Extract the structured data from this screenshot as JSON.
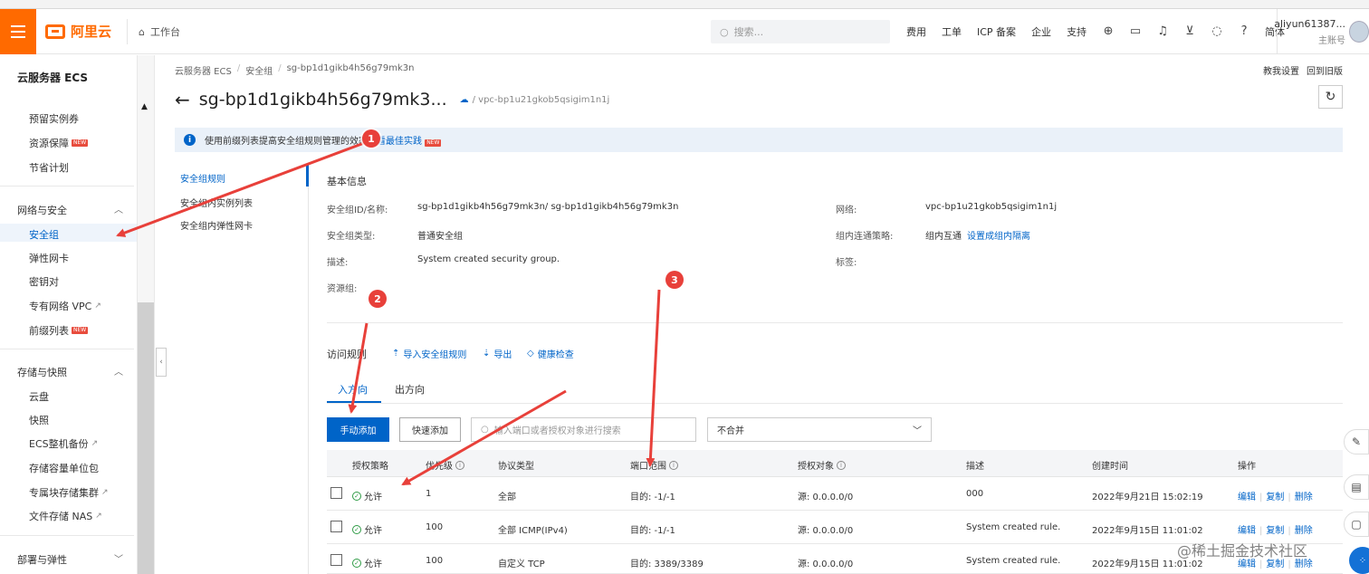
{
  "topbar": {
    "brand": "阿里云",
    "workbench": "工作台",
    "search_placeholder": "搜索...",
    "links": [
      "费用",
      "工单",
      "ICP 备案",
      "企业",
      "支持"
    ],
    "lang": "简体",
    "user_name": "aliyun61387...",
    "user_sub": "主账号"
  },
  "sidebar": {
    "title": "云服务器 ECS",
    "top_items": [
      "预留实例券",
      "资源保障",
      "节省计划"
    ],
    "group_network": "网络与安全",
    "network_items": [
      "安全组",
      "弹性网卡",
      "密钥对",
      "专有网络 VPC",
      "前缀列表"
    ],
    "group_storage": "存储与快照",
    "storage_items": [
      "云盘",
      "快照",
      "ECS整机备份",
      "存储容量单位包",
      "专属块存储集群",
      "文件存储 NAS"
    ],
    "group_deploy": "部署与弹性",
    "new_badge": "NEW"
  },
  "breadcrumb": [
    "云服务器 ECS",
    "安全组",
    "sg-bp1d1gikb4h56g79mk3n"
  ],
  "top_right_links": [
    "教我设置",
    "回到旧版"
  ],
  "page": {
    "title": "sg-bp1d1gikb4h56g79mk3...",
    "vpc": "/ vpc-bp1u21gkob5qsigim1n1j"
  },
  "banner": {
    "text": "使用前缀列表提高安全组规则管理的效率",
    "link": "查看最佳实践"
  },
  "left_tabs": [
    "安全组规则",
    "安全组内实例列表",
    "安全组内弹性网卡"
  ],
  "basic_info": {
    "title": "基本信息",
    "id_label": "安全组ID/名称:",
    "id_value": "sg-bp1d1gikb4h56g79mk3n/ sg-bp1d1gikb4h56g79mk3n",
    "type_label": "安全组类型:",
    "type_value": "普通安全组",
    "desc_label": "描述:",
    "desc_value": "System created security group.",
    "rg_label": "资源组:",
    "network_label": "网络:",
    "network_value": "vpc-bp1u21gkob5qsigim1n1j",
    "policy_label": "组内连通策略:",
    "policy_value": "组内互通",
    "policy_link": "设置成组内隔离",
    "tags_label": "标签:"
  },
  "rules": {
    "title": "访问规则",
    "import": "导入安全组规则",
    "export": "导出",
    "health": "健康检查",
    "tab_in": "入方向",
    "tab_out": "出方向",
    "btn_manual": "手动添加",
    "btn_quick": "快速添加",
    "search_placeholder": "输入端口或者授权对象进行搜索",
    "select_value": "不合并",
    "columns": [
      "授权策略",
      "优先级",
      "协议类型",
      "端口范围",
      "授权对象",
      "描述",
      "创建时间",
      "操作"
    ],
    "rows": [
      {
        "policy": "允许",
        "priority": "1",
        "protocol": "全部",
        "port": "目的: -1/-1",
        "object": "源: 0.0.0.0/0",
        "desc": "000",
        "time": "2022年9月21日 15:02:19"
      },
      {
        "policy": "允许",
        "priority": "100",
        "protocol": "全部 ICMP(IPv4)",
        "port": "目的: -1/-1",
        "object": "源: 0.0.0.0/0",
        "desc": "System created rule.",
        "time": "2022年9月15日 11:01:02"
      },
      {
        "policy": "允许",
        "priority": "100",
        "protocol": "自定义 TCP",
        "port": "目的: 3389/3389",
        "object": "源: 0.0.0.0/0",
        "desc": "System created rule.",
        "time": "2022年9月15日 11:01:02"
      }
    ],
    "ops": [
      "编辑",
      "复制",
      "删除"
    ]
  },
  "annotations": [
    "1",
    "2",
    "3"
  ],
  "watermark": "@稀土掘金技术社区",
  "colors": {
    "brand": "#ff6a00",
    "primary": "#0064c8",
    "annotation": "#e8403a"
  }
}
